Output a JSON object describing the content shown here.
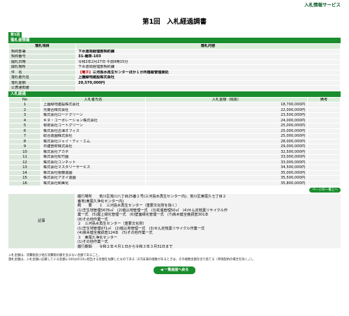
{
  "header": {
    "brand": "入札情報サービス",
    "title": "第1回　入札経過調書",
    "round_tag": "第1回"
  },
  "info": {
    "section_title": "落札者情報",
    "col_item": "落札項目",
    "col_content": "落札内容",
    "rows": [
      {
        "label": "契約部署",
        "value": "下水道局経理部契約課"
      },
      {
        "label": "契約番号",
        "value": "31-補草-103"
      },
      {
        "label": "開札日時",
        "value": "令和2年2月27日 午前9時15分"
      },
      {
        "label": "開札場所",
        "value": "下水道局経理部契約課"
      },
      {
        "label": "件　名",
        "mark": "【電子】",
        "value": "三河島水再生センターほか１か所植栽管理委託"
      },
      {
        "label": "落札者氏名",
        "value": "上園緑地建設株式会社"
      },
      {
        "label": "落札金額",
        "value": "20,570,000円"
      },
      {
        "label": "公表通知書",
        "value": ""
      }
    ]
  },
  "bids": {
    "section_title": "入札経過",
    "col_no": "No",
    "col_name": "入札者氏名",
    "col_amount": "入札金額（税抜）",
    "col_note": "備考",
    "rows": [
      {
        "no": "1",
        "name": "上園緑地建設株式会社",
        "amount": "18,700,000円",
        "note": ""
      },
      {
        "no": "2",
        "name": "光南合株式会社",
        "amount": "22,000,000円",
        "note": ""
      },
      {
        "no": "3",
        "name": "株式会社ロードクリーン",
        "amount": "23,500,000円",
        "note": ""
      },
      {
        "no": "4",
        "name": "キヌ・コーポレーション株式会社",
        "amount": "24,000,000円",
        "note": ""
      },
      {
        "no": "5",
        "name": "有限会社コートグリーン",
        "amount": "25,000,000円",
        "note": ""
      },
      {
        "no": "6",
        "name": "株式会社古澤オフィス",
        "amount": "25,000,000円",
        "note": ""
      },
      {
        "no": "7",
        "name": "総合造園株式会社",
        "amount": "25,000,000円",
        "note": ""
      },
      {
        "no": "8",
        "name": "株式会社ジェイ・ティ・エム",
        "amount": "28,000,000円",
        "note": ""
      },
      {
        "no": "9",
        "name": "日建管財株式会社",
        "amount": "29,000,000円",
        "note": ""
      },
      {
        "no": "10",
        "name": "株式会社アカネ",
        "amount": "32,500,000円",
        "note": ""
      },
      {
        "no": "11",
        "name": "株式会社松竹園",
        "amount": "33,000,000円",
        "note": ""
      },
      {
        "no": "12",
        "name": "株式会社コンネット",
        "amount": "33,000,000円",
        "note": ""
      },
      {
        "no": "13",
        "name": "株式会社マスタリーサービス",
        "amount": "34,500,000円",
        "note": ""
      },
      {
        "no": "14",
        "name": "株式会社後藤造園",
        "amount": "35,000,000円",
        "note": ""
      },
      {
        "no": "15",
        "name": "株式会社アオイ造園",
        "amount": "35,500,000円",
        "note": ""
      },
      {
        "no": "16",
        "name": "株式会社和美化",
        "amount": "35,800,000円",
        "note": ""
      }
    ],
    "page_top_label": "ページの一番上へ"
  },
  "remarks": {
    "label": "記事",
    "lines": [
      "履行場所　　荒川区荒川八丁目25番１号(三河島水再生センター内)、荒川区東尾久七丁目２",
      "番地(東尾久浄化センター内)",
      "概　　要　　１　三河島水再生センター（重要文化財を除く）",
      "(1)芝生地管理5676㎡　(2)植込地管理一式　(3)花壇管理50㎡　(4)せん定枝葉リサイクル作",
      "業一式　(5)屋上緑化管理一式　(6)壁面緑化管理一式　(7)高木健全度調査301本",
      "(8)その他作業一式",
      "２　三河島水再生センター（重要文化財）",
      "(1)芝生地管理971㎡　(2)植込地管理一式　(3)せん定枝葉リサイクル作業一式",
      "(4)高木健全度調査124本　(5)その他作業一式",
      "３　東尾久浄化センター",
      "(1)その他作業一式",
      "履行期間　　令和２年４月１日から令和３年３月31日まで"
    ]
  },
  "notes": {
    "line1": "入札金額は、消費税及び地方消費税の額を含まない金額であること。",
    "line2": "落札金額は、入札金額に記載している金額に100分の10に相当する金額を加算したものである（1円未満の端数があるときは、その端数金額を切り捨てる（単価契約の場合を除く。））。"
  },
  "footer": {
    "back_label": "◀ 一覧画面へ戻る"
  }
}
